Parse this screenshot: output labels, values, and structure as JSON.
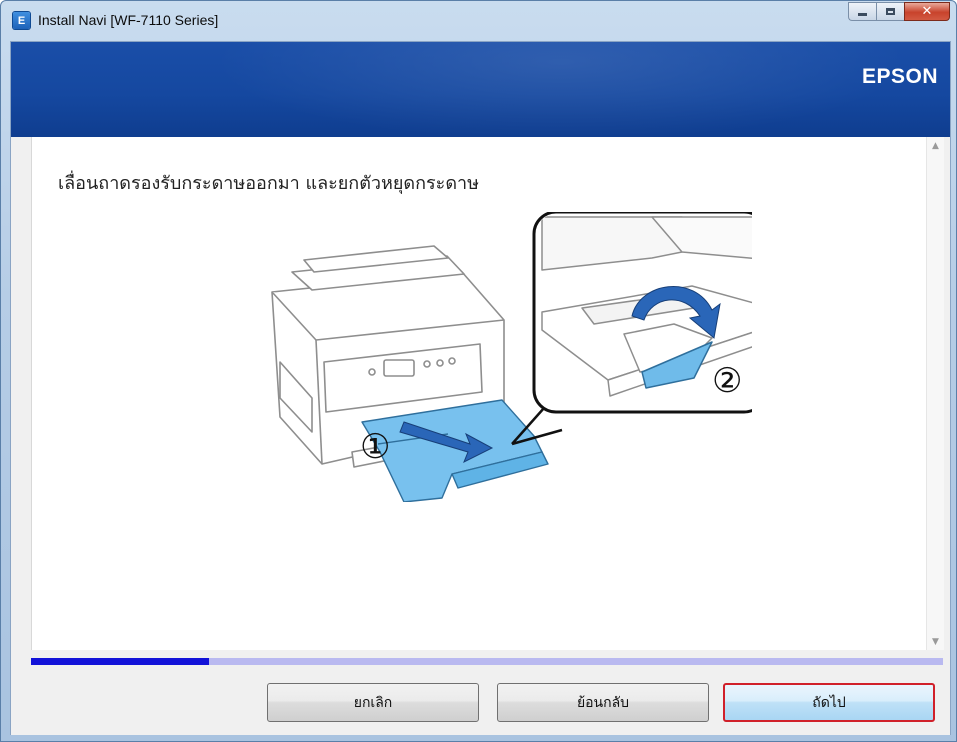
{
  "window": {
    "title": "Install Navi [WF-7110 Series]",
    "app_icon_letter": "E",
    "controls": {
      "minimize": "minimize",
      "maximize": "maximize",
      "close": "close"
    }
  },
  "header": {
    "brand": "EPSON",
    "band_color": "#1a4ea8"
  },
  "content": {
    "instruction": "เลื่อนถาดรองรับกระดาษออกมา และยกตัวหยุดกระดาษ",
    "illustration": {
      "step1_label": "①",
      "step2_label": "②"
    }
  },
  "progress": {
    "fraction": 0.195,
    "fill_color": "#1212d8",
    "track_color": "#b9b9f0"
  },
  "buttons": {
    "cancel": "ยกเลิก",
    "back": "ย้อนกลับ",
    "next": "ถัดไป"
  },
  "colors": {
    "highlight_border": "#d0202a",
    "tray_blue": "#5fb3e6"
  }
}
